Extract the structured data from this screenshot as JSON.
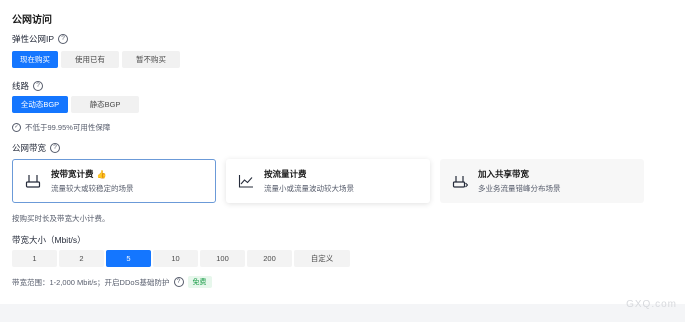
{
  "section_title": "公网访问",
  "eip": {
    "label": "弹性公网IP",
    "options": [
      "现在购买",
      "使用已有",
      "暂不购买"
    ],
    "selected": 0
  },
  "line": {
    "label": "线路",
    "options": [
      "全动态BGP",
      "静态BGP"
    ],
    "selected": 0,
    "note": "不低于99.95%可用性保障"
  },
  "billing": {
    "label": "公网带宽",
    "cards": [
      {
        "title": "按带宽计费",
        "desc": "流量较大或较稳定的场景",
        "icon": "bandwidth-icon",
        "thumb": "thumb-up-icon"
      },
      {
        "title": "按流量计费",
        "desc": "流量小或流量波动较大场景",
        "icon": "traffic-chart-icon"
      },
      {
        "title": "加入共享带宽",
        "desc": "多业务流量错峰分布场景",
        "icon": "shared-bandwidth-icon"
      }
    ],
    "selected": 0,
    "note": "按购买时长及带宽大小计费。"
  },
  "bandwidth": {
    "label": "带宽大小（Mbit/s）",
    "options": [
      "1",
      "2",
      "5",
      "10",
      "100",
      "200",
      "自定义"
    ],
    "selected": 2,
    "range_note": "带宽范围：1-2,000 Mbit/s；开启DDoS基础防护",
    "badge": "免费"
  },
  "watermark": "GXQ.com",
  "colors": {
    "accent": "#1476ff",
    "badge_bg": "#e7f7ec",
    "badge_text": "#1a9c48"
  }
}
